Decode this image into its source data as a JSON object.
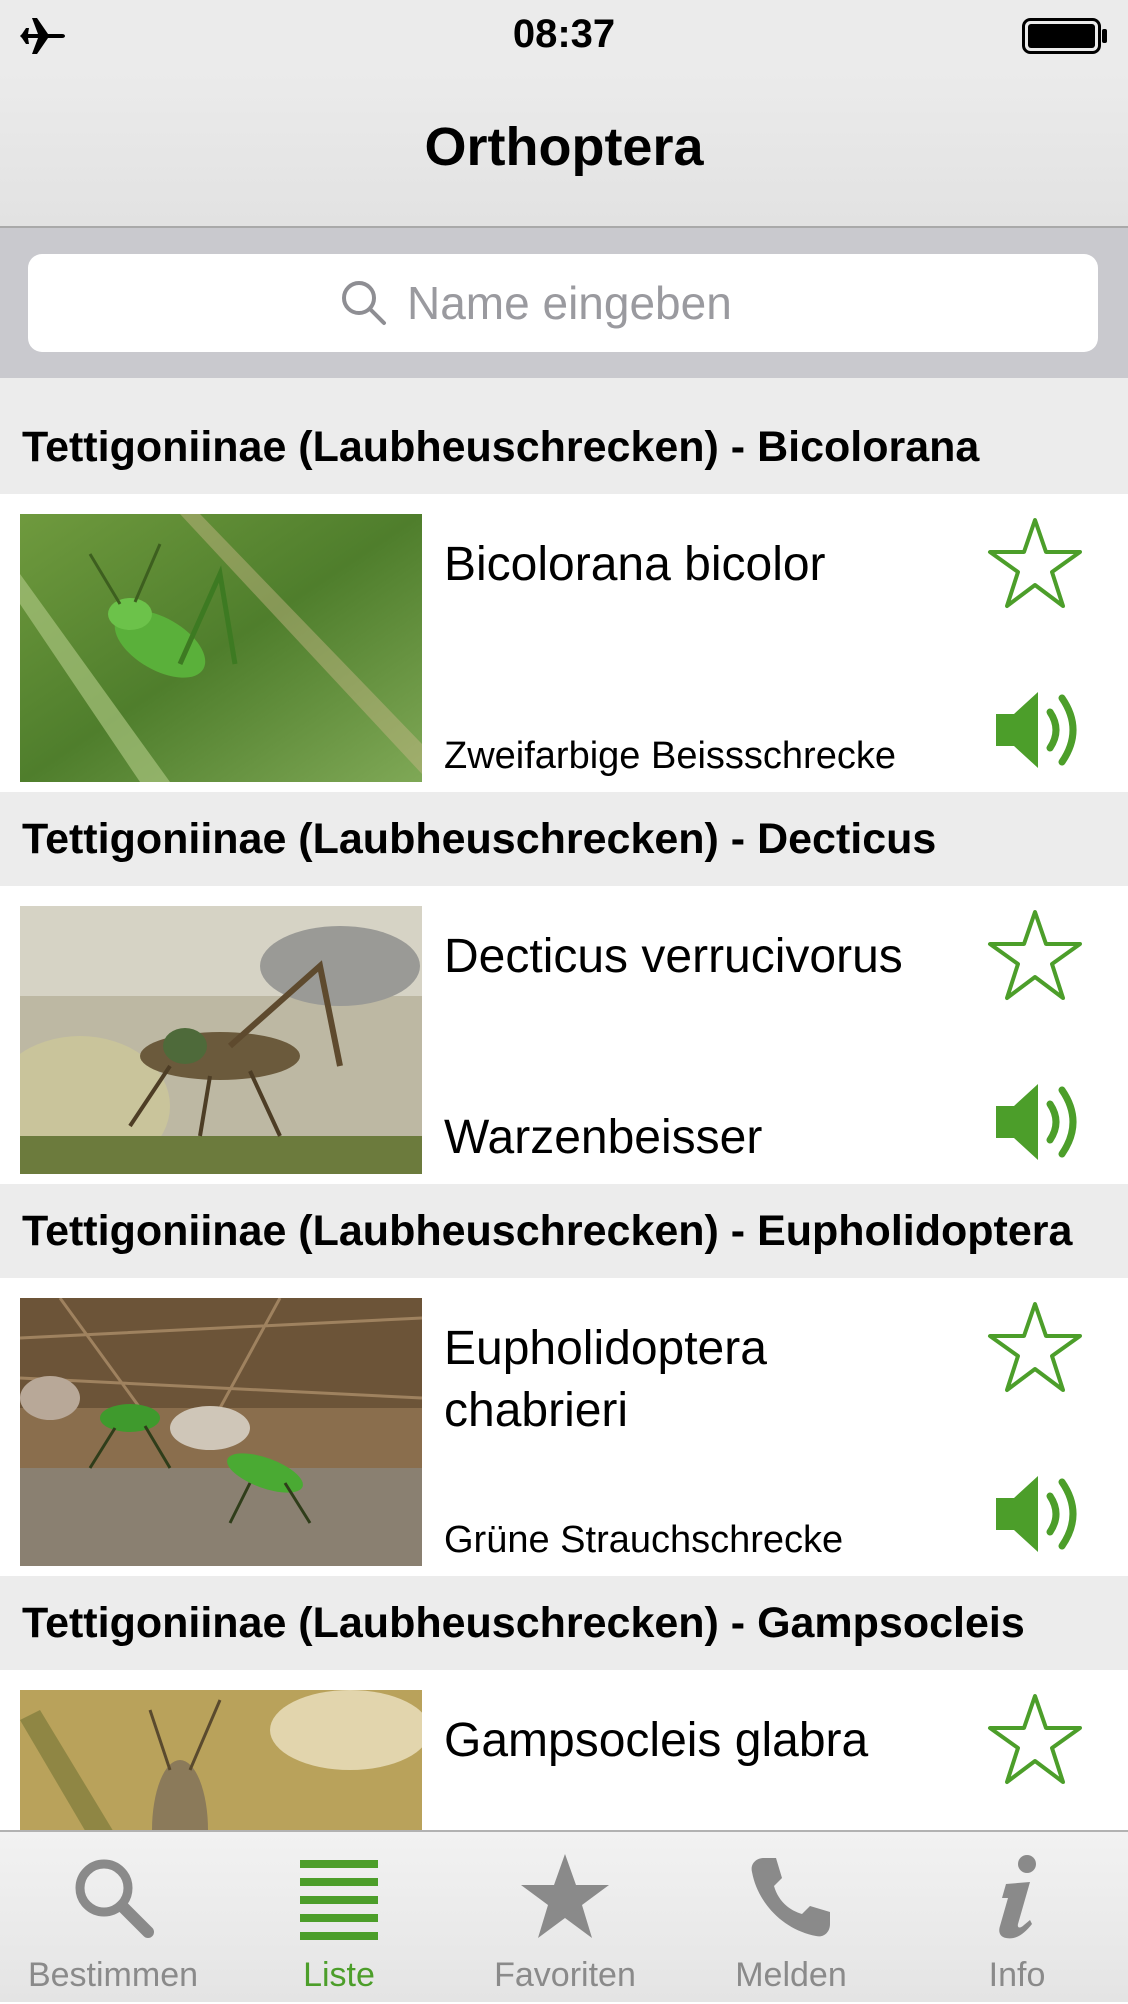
{
  "status_bar": {
    "time": "08:37"
  },
  "nav": {
    "title": "Orthoptera"
  },
  "search": {
    "placeholder": "Name eingeben"
  },
  "sections": [
    {
      "header": "Tettigoniinae (Laubheuschrecken) - Bicolorana",
      "species": {
        "scientific_name": "Bicolorana bicolor",
        "common_name": "Zweifarbige Beissschrecke",
        "favorite": false
      }
    },
    {
      "header": "Tettigoniinae (Laubheuschrecken) - Decticus",
      "species": {
        "scientific_name": "Decticus verrucivorus",
        "common_name": "Warzenbeisser",
        "favorite": false
      }
    },
    {
      "header": "Tettigoniinae (Laubheuschrecken) - Eupholidoptera",
      "species": {
        "scientific_name": "Eupholidoptera chabrieri",
        "common_name": "Grüne Strauchschrecke",
        "favorite": false
      }
    },
    {
      "header": "Tettigoniinae (Laubheuschrecken) - Gampsocleis",
      "species": {
        "scientific_name": "Gampsocleis glabra",
        "common_name": "",
        "favorite": false
      }
    }
  ],
  "tab_bar": {
    "active": "Liste",
    "tabs": [
      {
        "label": "Bestimmen",
        "icon": "search-icon"
      },
      {
        "label": "Liste",
        "icon": "list-icon"
      },
      {
        "label": "Favoriten",
        "icon": "star-icon"
      },
      {
        "label": "Melden",
        "icon": "phone-icon"
      },
      {
        "label": "Info",
        "icon": "info-icon"
      }
    ]
  },
  "colors": {
    "accent": "#4c9e2a",
    "tab_inactive": "#8a8a8a",
    "section_header_bg": "#ececec"
  }
}
